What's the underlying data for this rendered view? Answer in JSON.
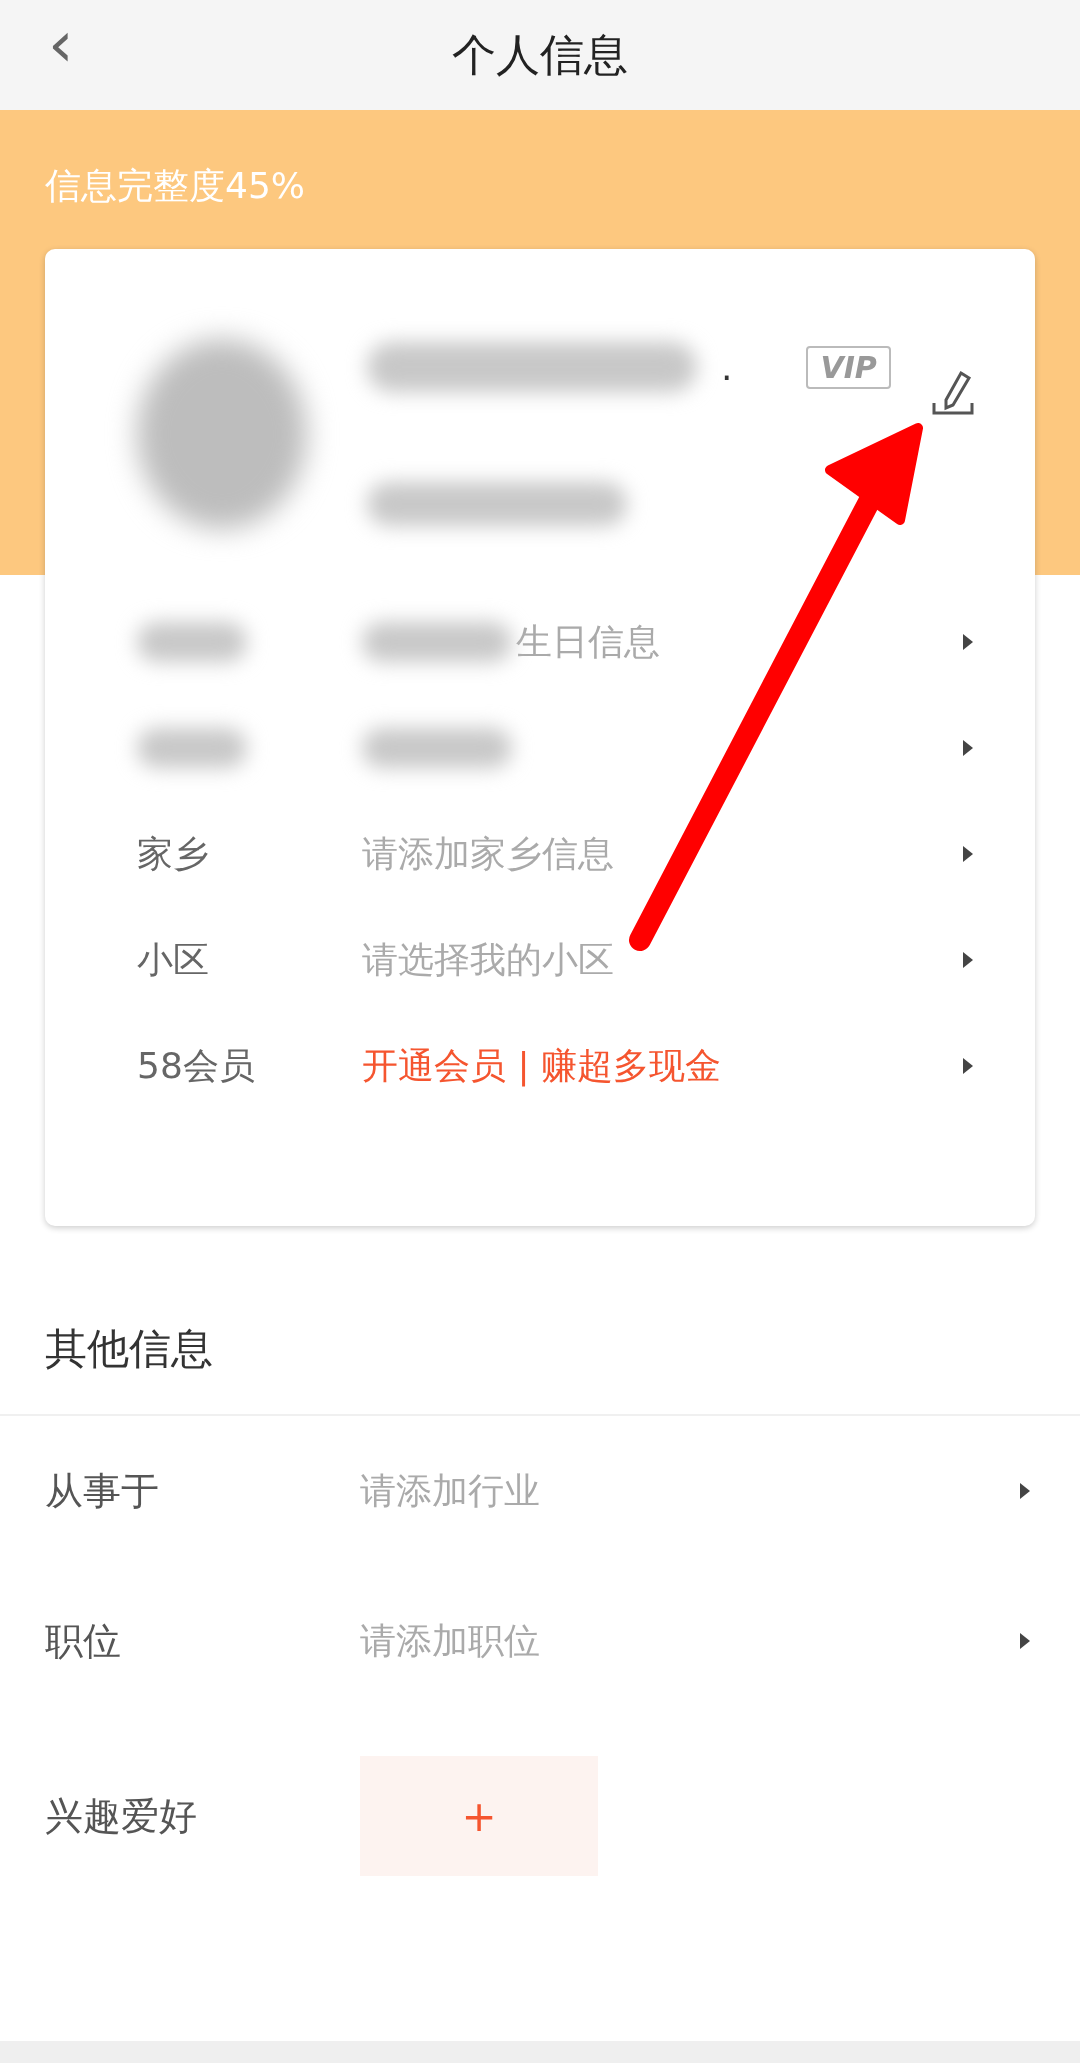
{
  "header": {
    "back": "‹",
    "title": "个人信息"
  },
  "completeness": "信息完整度45%",
  "profile": {
    "avatar_blurred": true,
    "name_blurred": true,
    "name_suffix": ".",
    "badge": "VIP",
    "subtitle_blurred": true
  },
  "basic_rows": [
    {
      "label_blurred": true,
      "value_blurred": true,
      "value": "生日信息",
      "highlight": false
    },
    {
      "label_blurred": true,
      "value_blurred": true
    },
    {
      "label": "家乡",
      "value": "请添加家乡信息",
      "highlight": false
    },
    {
      "label": "小区",
      "value": "请选择我的小区",
      "highlight": false
    },
    {
      "label": "58会员",
      "value": "开通会员 | 赚超多现金",
      "highlight": true
    }
  ],
  "other": {
    "title": "其他信息",
    "rows": [
      {
        "kind": "link",
        "label": "从事于",
        "value": "请添加行业"
      },
      {
        "kind": "link",
        "label": "职位",
        "value": "请添加职位"
      },
      {
        "kind": "add",
        "label": "兴趣爱好",
        "button": "+"
      }
    ]
  }
}
